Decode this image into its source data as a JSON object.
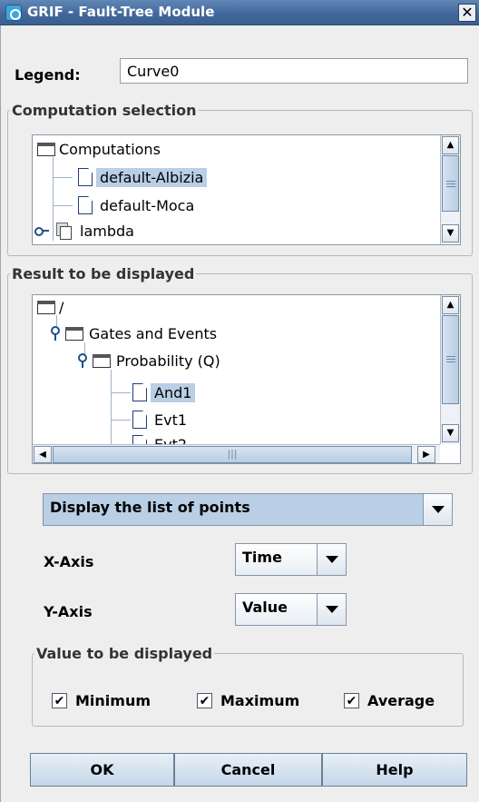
{
  "window": {
    "title": "GRIF - Fault-Tree Module",
    "close_glyph": "✕"
  },
  "legend": {
    "label": "Legend:",
    "value": "Curve0"
  },
  "computation_selection": {
    "title": "Computation selection",
    "items": [
      {
        "label": "Computations",
        "icon": "folder-icon"
      },
      {
        "label": "default-Albizia",
        "icon": "document-icon",
        "selected": true
      },
      {
        "label": "default-Moca",
        "icon": "document-icon"
      },
      {
        "label": "lambda",
        "icon": "stack-icon"
      }
    ]
  },
  "result_display": {
    "title": "Result to be displayed",
    "items": [
      {
        "label": "/",
        "icon": "folder-icon"
      },
      {
        "label": "Gates and Events",
        "icon": "folder-icon"
      },
      {
        "label": "Probability (Q)",
        "icon": "folder-icon"
      },
      {
        "label": "And1",
        "icon": "document-icon",
        "selected": true
      },
      {
        "label": "Evt1",
        "icon": "document-icon"
      },
      {
        "label": "Evt2",
        "icon": "document-icon"
      }
    ]
  },
  "display_mode": {
    "selected": "Display the list of points"
  },
  "x_axis": {
    "label": "X-Axis",
    "selected": "Time"
  },
  "y_axis": {
    "label": "Y-Axis",
    "selected": "Value"
  },
  "value_display": {
    "title": "Value to be displayed",
    "checkboxes": [
      {
        "label": "Minimum",
        "checked": true
      },
      {
        "label": "Maximum",
        "checked": true
      },
      {
        "label": "Average",
        "checked": true
      }
    ],
    "check_glyph": "✔"
  },
  "buttons": {
    "ok": "OK",
    "cancel": "Cancel",
    "help": "Help"
  },
  "colors": {
    "selection": "#b8cfe5",
    "titlebar": "#41679a",
    "background": "#eeeeee"
  }
}
